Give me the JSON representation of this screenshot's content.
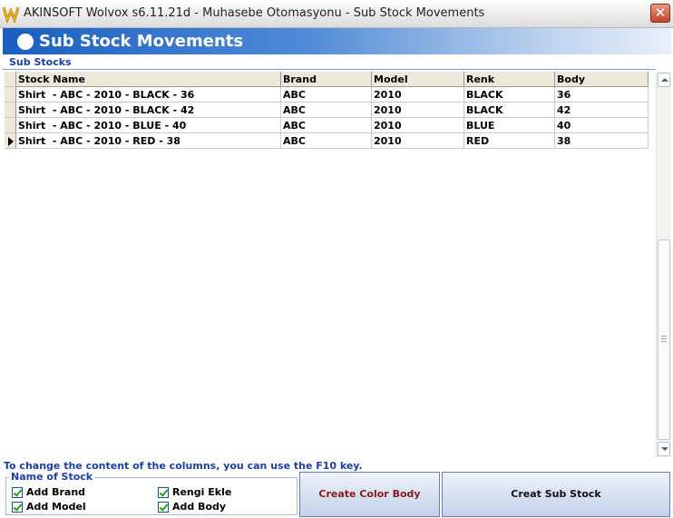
{
  "window": {
    "title": "AKINSOFT Wolvox s6.11.21d - Muhasebe Otomasyonu - Sub Stock Movements",
    "close_label": "✕"
  },
  "header": {
    "title": "Sub Stock Movements"
  },
  "section_label": "Sub Stocks",
  "grid": {
    "columns": [
      "Stock Name",
      "Brand",
      "Model",
      "Renk",
      "Body"
    ],
    "rows": [
      [
        "Shirt  - ABC - 2010 - BLACK - 36",
        "ABC",
        "2010",
        "BLACK",
        "36"
      ],
      [
        "Shirt  - ABC - 2010 - BLACK - 42",
        "ABC",
        "2010",
        "BLACK",
        "42"
      ],
      [
        "Shirt  - ABC - 2010 - BLUE - 40",
        "ABC",
        "2010",
        "BLUE",
        "40"
      ],
      [
        "Shirt  - ABC - 2010 - RED - 38",
        "ABC",
        "2010",
        "RED",
        "38"
      ]
    ],
    "current_row": 4
  },
  "hint": "To change the content of the columns, you can use the F10 key.",
  "options": {
    "legend": "Name of Stock",
    "add_brand": "Add Brand",
    "add_model": "Add Model",
    "rengi_ekle": "Rengi Ekle",
    "add_body": "Add Body"
  },
  "buttons": {
    "create_color_body": "Create Color Body",
    "creat_sub_stock": "Creat Sub Stock"
  },
  "colors": {
    "header_blue": "#1a5fc0",
    "label_blue": "#1a3fa0",
    "button_red_text": "#8b1a1a",
    "check_green": "#21a121"
  },
  "icons": [
    "akinsoft-w-logo-icon",
    "close-icon",
    "white-circle-icon",
    "row-pointer-icon",
    "scroll-up-icon",
    "scroll-down-icon"
  ]
}
